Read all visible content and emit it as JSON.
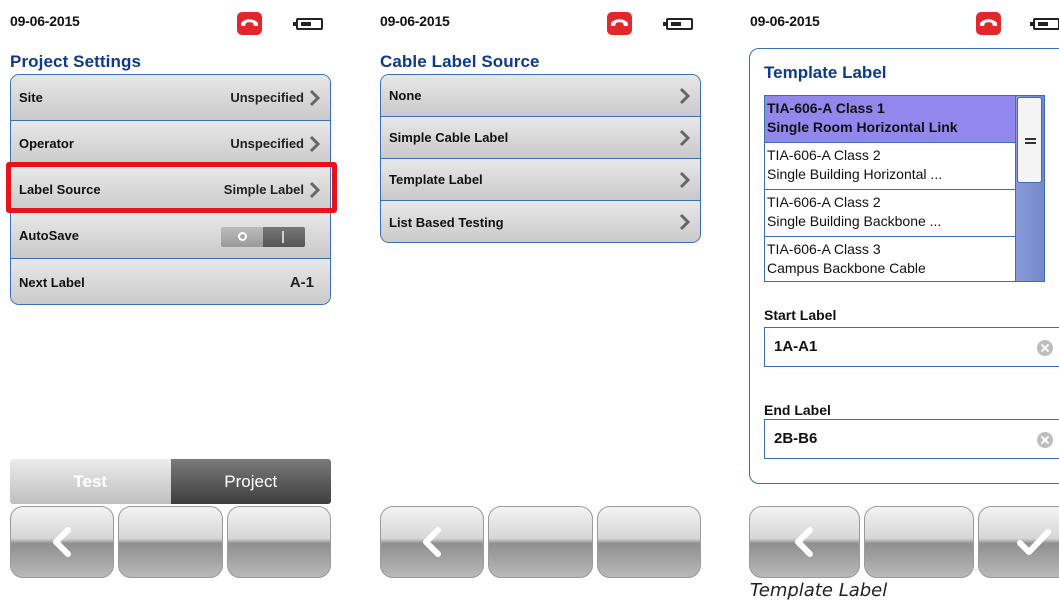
{
  "screen1": {
    "date": "09-06-2015",
    "title": "Project Settings",
    "rows": [
      {
        "label": "Site",
        "value": "Unspecified"
      },
      {
        "label": "Operator",
        "value": "Unspecified"
      },
      {
        "label": "Label Source",
        "value": "Simple Label"
      },
      {
        "label": "AutoSave",
        "toggle": "off"
      },
      {
        "label": "Next Label",
        "value": "A-1"
      }
    ],
    "tabs": {
      "test": "Test",
      "project": "Project",
      "active": "Project"
    }
  },
  "screen2": {
    "date": "09-06-2015",
    "title": "Cable Label Source",
    "items": [
      {
        "label": "None"
      },
      {
        "label": "Simple Cable Label"
      },
      {
        "label": "Template Label"
      },
      {
        "label": "List Based Testing"
      }
    ]
  },
  "screen3": {
    "date": "09-06-2015",
    "title": "Template Label",
    "templates": [
      {
        "line1": "TIA-606-A Class 1",
        "line2": "Single Room Horizontal Link",
        "selected": true
      },
      {
        "line1": "TIA-606-A Class 2",
        "line2": "Single Building Horizontal ...",
        "selected": false
      },
      {
        "line1": "TIA-606-A Class 2",
        "line2": "Single Building Backbone ...",
        "selected": false
      },
      {
        "line1": "TIA-606-A Class 3",
        "line2": "Campus Backbone Cable",
        "selected": false
      }
    ],
    "start_label": {
      "label": "Start Label",
      "value": "1A-A1"
    },
    "end_label": {
      "label": "End Label",
      "value": "2B-B6"
    }
  },
  "icons": {
    "phone": "phone-hangup-icon",
    "battery": "battery-icon",
    "back": "back-arrow-icon",
    "confirm": "checkmark-icon",
    "chevron": "chevron-right-icon",
    "clear": "clear-field-icon"
  },
  "colors": {
    "accent": "#0d3a8c",
    "border": "#3c6fb0",
    "phone": "#e3262b",
    "highlight": "#e8121a",
    "selection": "#9187ec"
  },
  "caption": "Template Label"
}
